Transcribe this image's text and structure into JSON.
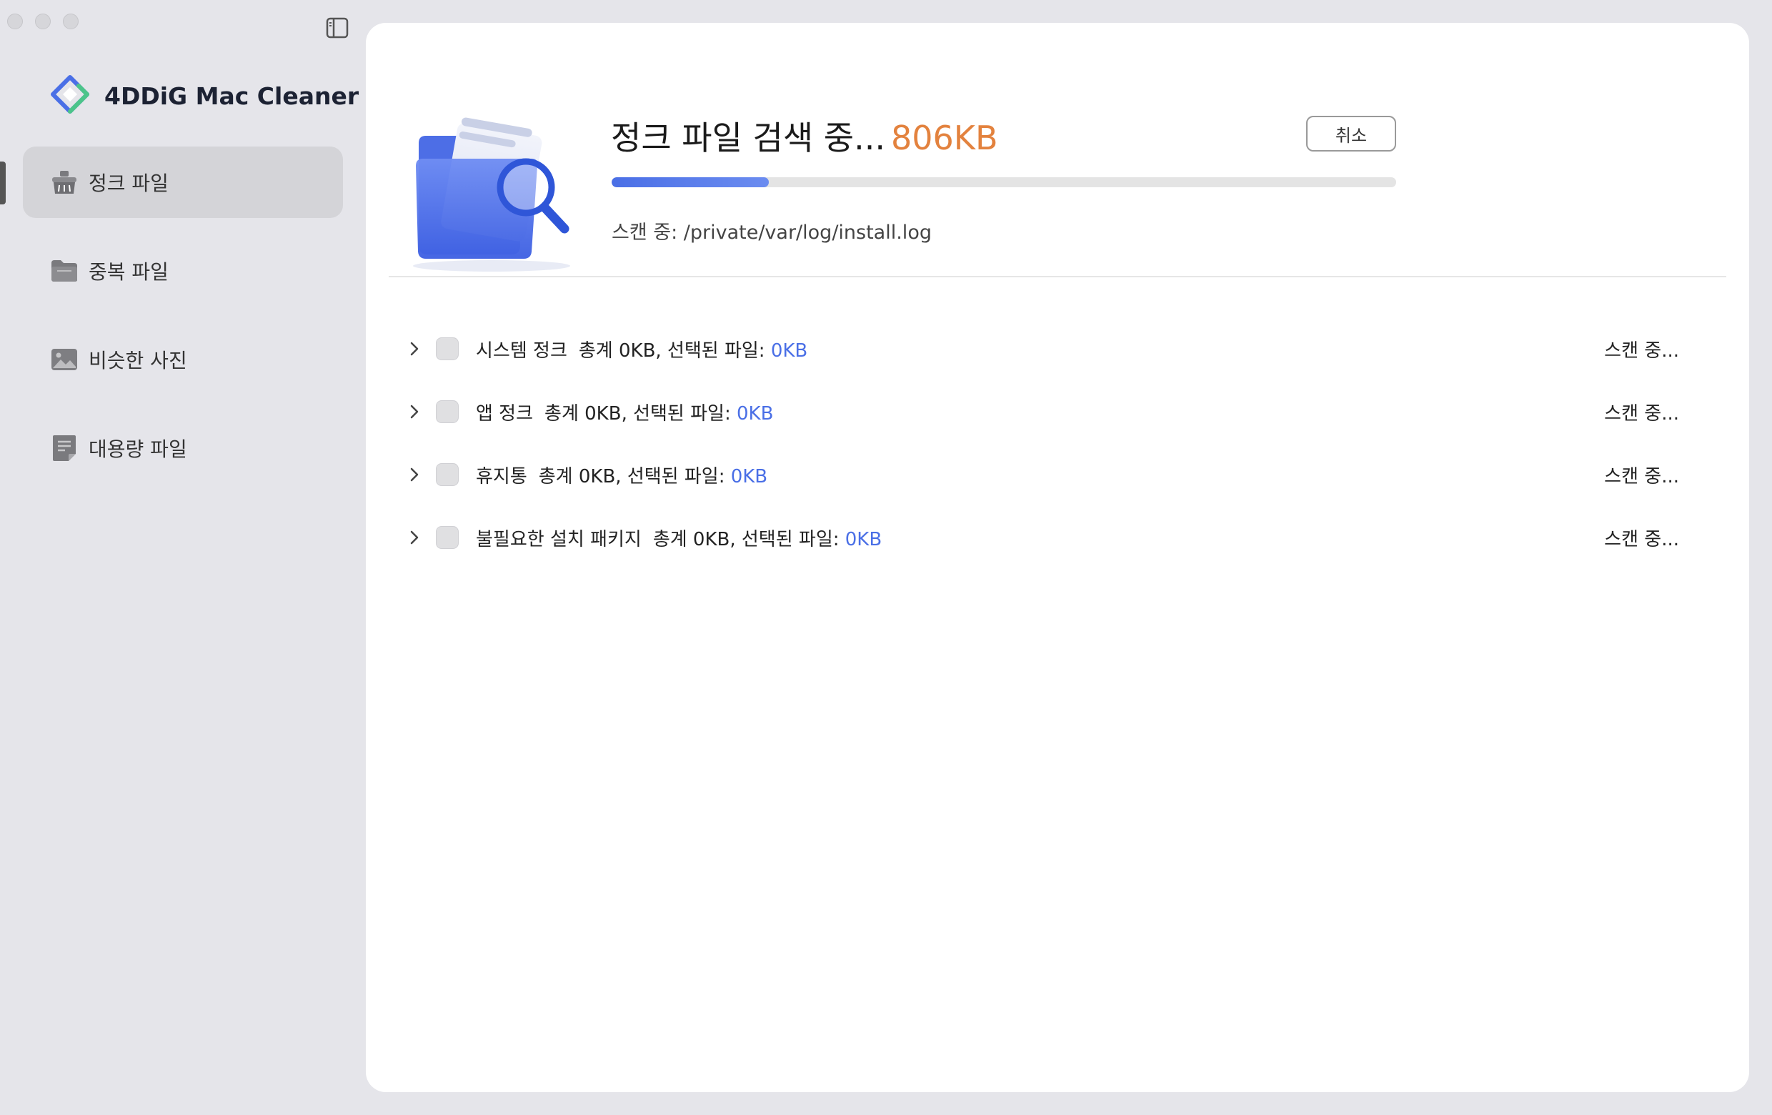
{
  "window": {
    "controls": [
      "close",
      "minimize",
      "zoom"
    ]
  },
  "sidebar": {
    "toggle_icon": "sidebar-toggle-icon",
    "brand": {
      "name": "4DDiG Mac Cleaner",
      "logo_icon": "4ddig-logo-icon"
    },
    "items": [
      {
        "label": "정크 파일",
        "icon": "broom-icon",
        "active": true
      },
      {
        "label": "중복 파일",
        "icon": "folder-icon",
        "active": false
      },
      {
        "label": "비슷한 사진",
        "icon": "photo-icon",
        "active": false
      },
      {
        "label": "대용량 파일",
        "icon": "large-file-icon",
        "active": false
      }
    ]
  },
  "scan": {
    "title": "정크 파일 검색 중...",
    "size": "806KB",
    "cancel_label": "취소",
    "progress_percent": 20,
    "path_text": "스캔 중: /private/var/log/install.log"
  },
  "categories": [
    {
      "name": "시스템 정크",
      "summary": "총계 0KB, 선택된 파일: ",
      "selected": "0KB",
      "status": "스캔 중..."
    },
    {
      "name": "앱 정크",
      "summary": "총계 0KB, 선택된 파일: ",
      "selected": "0KB",
      "status": "스캔 중..."
    },
    {
      "name": "휴지통",
      "summary": "총계 0KB, 선택된 파일: ",
      "selected": "0KB",
      "status": "스캔 중..."
    },
    {
      "name": "불필요한 설치 패키지",
      "summary": "총계 0KB, 선택된 파일: ",
      "selected": "0KB",
      "status": "스캔 중..."
    }
  ],
  "colors": {
    "accent": "#4a6fe6",
    "size_highlight": "#e3823e",
    "sidebar_bg": "#e5e5ea",
    "active_item_bg": "#d4d4d8"
  }
}
